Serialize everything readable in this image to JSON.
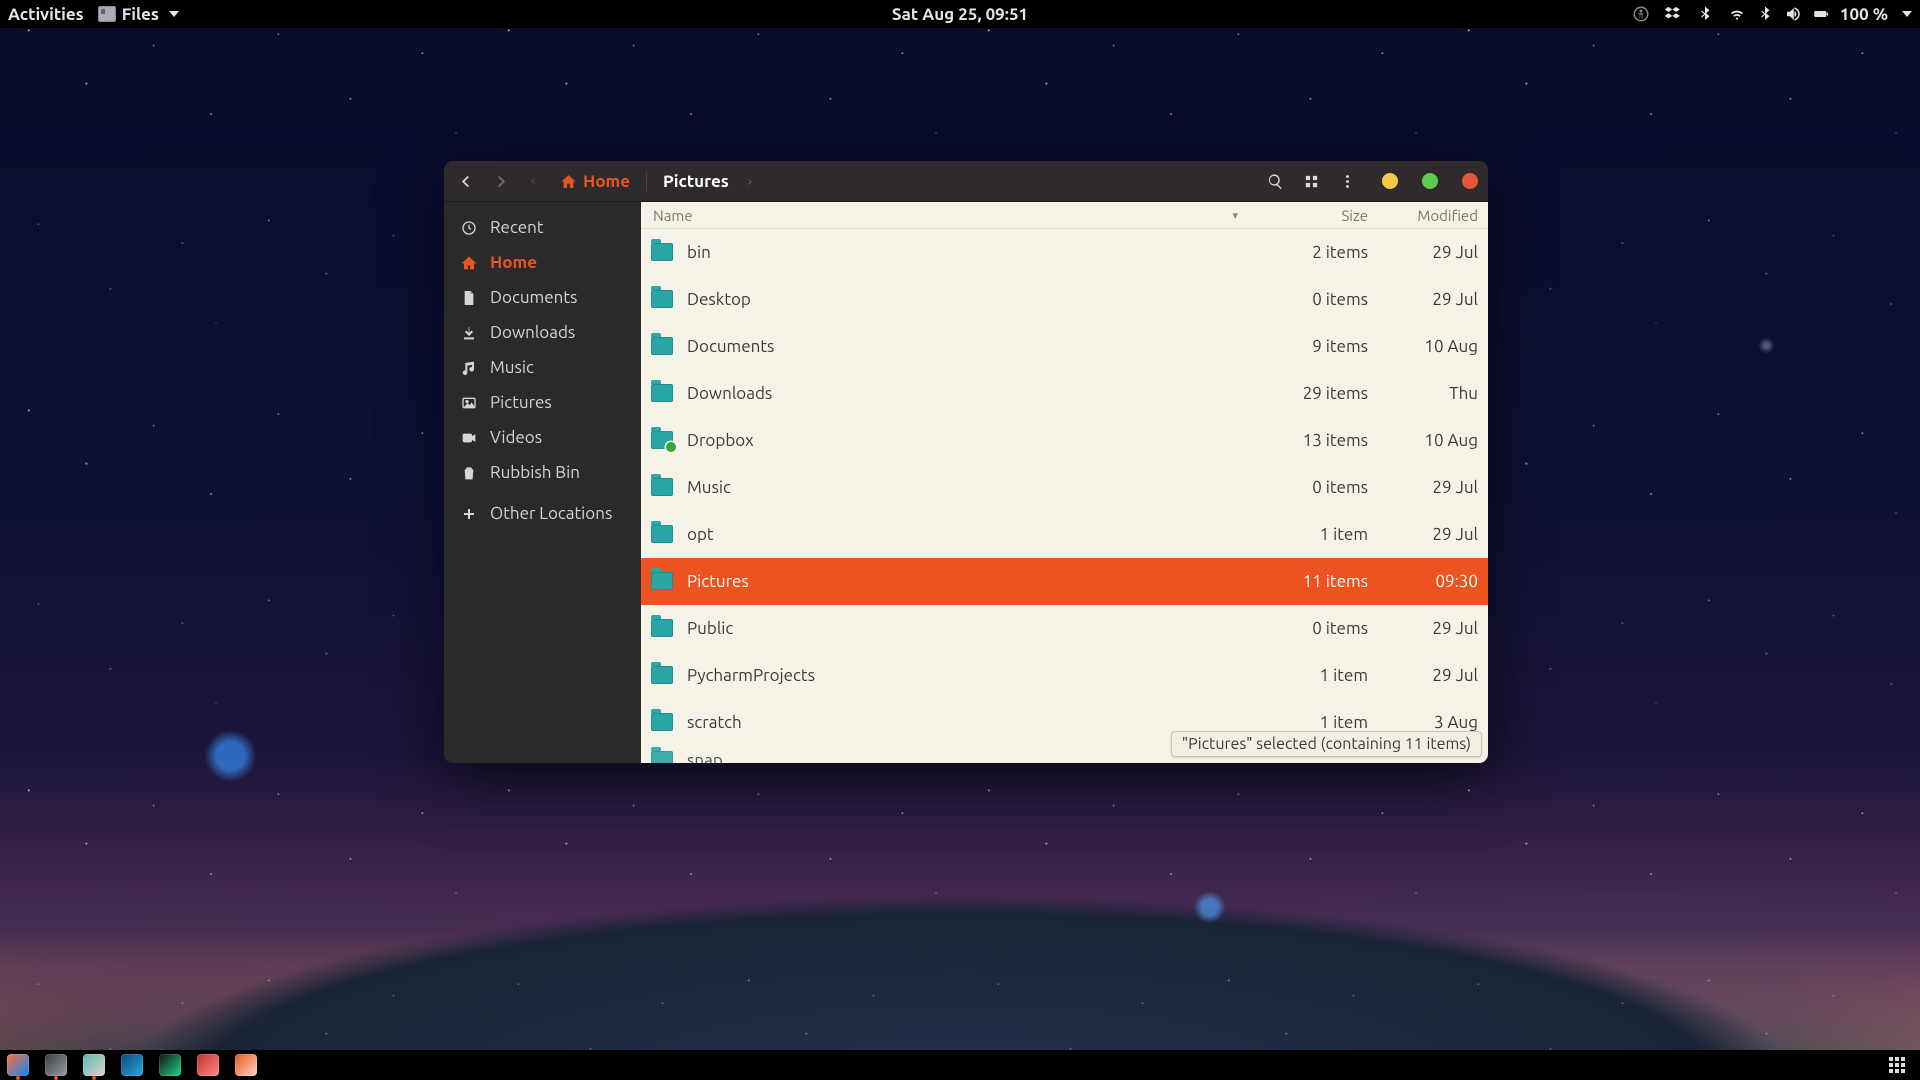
{
  "topbar": {
    "activities": "Activities",
    "app_label": "Files",
    "clock": "Sat Aug 25, 09:51",
    "battery": "100 %"
  },
  "window": {
    "path": {
      "home": "Home",
      "current": "Pictures"
    },
    "columns": {
      "name": "Name",
      "size": "Size",
      "modified": "Modified"
    },
    "status": "\"Pictures\" selected  (containing 11 items)"
  },
  "sidebar": {
    "items": [
      {
        "label": "Recent",
        "icon": "clock-icon"
      },
      {
        "label": "Home",
        "icon": "home-icon",
        "active": true
      },
      {
        "label": "Documents",
        "icon": "document-icon"
      },
      {
        "label": "Downloads",
        "icon": "download-icon"
      },
      {
        "label": "Music",
        "icon": "music-icon"
      },
      {
        "label": "Pictures",
        "icon": "picture-icon"
      },
      {
        "label": "Videos",
        "icon": "video-icon"
      },
      {
        "label": "Rubbish Bin",
        "icon": "trash-icon"
      },
      {
        "label": "Other Locations",
        "icon": "plus-icon",
        "separated": true
      }
    ]
  },
  "files": [
    {
      "name": "bin",
      "size": "2 items",
      "modified": "29 Jul"
    },
    {
      "name": "Desktop",
      "size": "0 items",
      "modified": "29 Jul"
    },
    {
      "name": "Documents",
      "size": "9 items",
      "modified": "10 Aug"
    },
    {
      "name": "Downloads",
      "size": "29 items",
      "modified": "Thu"
    },
    {
      "name": "Dropbox",
      "size": "13 items",
      "modified": "10 Aug",
      "badge": true
    },
    {
      "name": "Music",
      "size": "0 items",
      "modified": "29 Jul"
    },
    {
      "name": "opt",
      "size": "1 item",
      "modified": "29 Jul"
    },
    {
      "name": "Pictures",
      "size": "11 items",
      "modified": "09:30",
      "selected": true
    },
    {
      "name": "Public",
      "size": "0 items",
      "modified": "29 Jul"
    },
    {
      "name": "PycharmProjects",
      "size": "1 item",
      "modified": "29 Jul"
    },
    {
      "name": "scratch",
      "size": "1 item",
      "modified": "3 Aug"
    },
    {
      "name": "snap",
      "size": "",
      "modified": "",
      "peek": true
    }
  ],
  "dock": {
    "apps": [
      {
        "name": "firefox",
        "running": true,
        "color1": "#ff7139",
        "color2": "#0a84ff"
      },
      {
        "name": "system-monitor",
        "running": true,
        "color1": "#3a3a3a",
        "color2": "#9aa0a6"
      },
      {
        "name": "files",
        "running": true,
        "color1": "#5fb6b6",
        "color2": "#d9d4c6"
      },
      {
        "name": "vscode",
        "running": false,
        "color1": "#0a4a7a",
        "color2": "#2aa6e0"
      },
      {
        "name": "pycharm",
        "running": false,
        "color1": "#0f0f0f",
        "color2": "#21d789"
      },
      {
        "name": "rubymine",
        "running": false,
        "color1": "#c22f2f",
        "color2": "#ff8a8a"
      },
      {
        "name": "software",
        "running": false,
        "color1": "#e95420",
        "color2": "#ffd6c2"
      }
    ]
  }
}
